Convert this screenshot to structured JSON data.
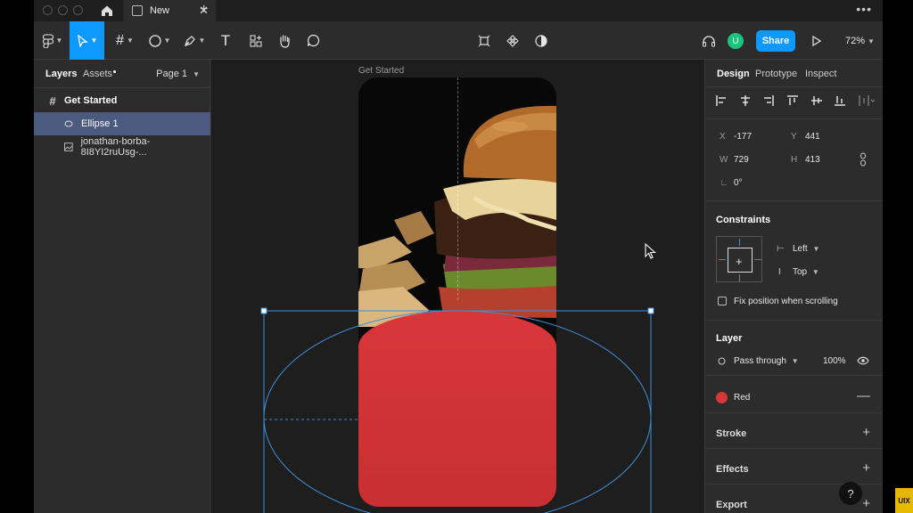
{
  "tab": {
    "label": "New"
  },
  "toolbar": {
    "share_label": "Share",
    "avatar_letter": "U",
    "zoom": "72%"
  },
  "layers_panel": {
    "tab_layers": "Layers",
    "tab_assets": "Assets",
    "page_label": "Page 1",
    "layers": [
      {
        "name": "Get Started",
        "icon": "frame-icon"
      },
      {
        "name": "Ellipse 1",
        "icon": "ellipse-icon",
        "selected": true
      },
      {
        "name": "jonathan-borba-8I8YI2ruUsg-...",
        "icon": "image-icon"
      }
    ]
  },
  "canvas": {
    "frame_label": "Get Started"
  },
  "design_panel": {
    "tabs": [
      "Design",
      "Prototype",
      "Inspect"
    ],
    "x_label": "X",
    "x_value": "-177",
    "y_label": "Y",
    "y_value": "441",
    "w_label": "W",
    "w_value": "729",
    "h_label": "H",
    "h_value": "413",
    "rotation": "0°",
    "constraints_title": "Constraints",
    "constraint_h": "Left",
    "constraint_v": "Top",
    "fix_position": "Fix position when scrolling",
    "layer_title": "Layer",
    "blend_mode": "Pass through",
    "opacity": "100%",
    "fill_name": "Red",
    "fill_color": "#d8373a",
    "stroke_title": "Stroke",
    "effects_title": "Effects",
    "export_title": "Export"
  },
  "help_label": "?",
  "watermark": "UIX",
  "colors": {
    "accent": "#0d99ff",
    "selection": "#4c5a80",
    "avatar": "#1bc47d"
  }
}
